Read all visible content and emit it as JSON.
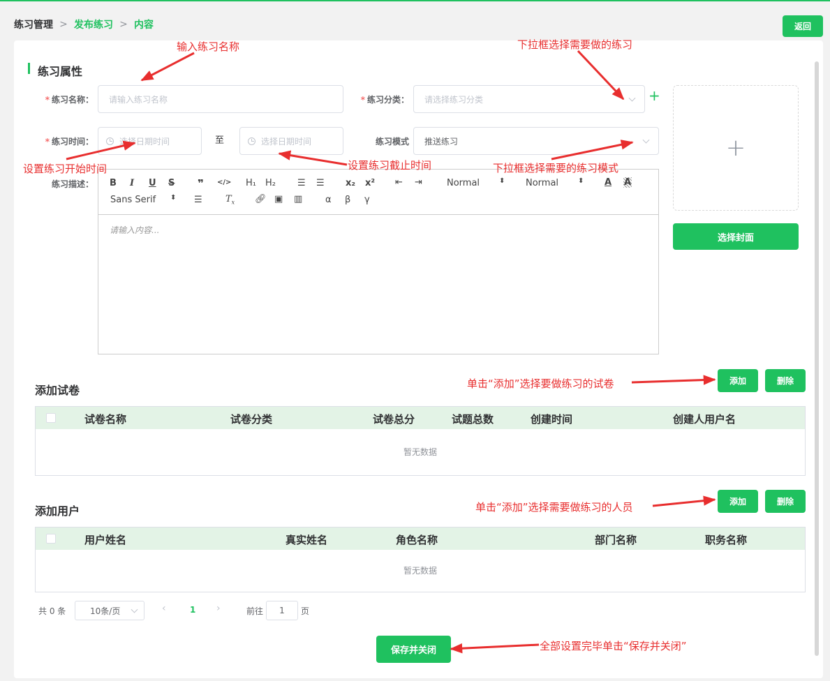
{
  "breadcrumb": {
    "level1": "练习管理",
    "level2": "发布练习",
    "level3": "内容",
    "separator": ">"
  },
  "header": {
    "back_label": "返回"
  },
  "section": {
    "title": "练习属性"
  },
  "form": {
    "required_mark": "*",
    "name_label": "练习名称：",
    "name_placeholder": "请输入练习名称",
    "category_label": "练习分类：",
    "category_placeholder": "请选择练习分类",
    "time_label": "练习时间：",
    "start_placeholder": "选择日期时间",
    "to_label": "至",
    "end_placeholder": "选择日期时间",
    "mode_label": "练习模式",
    "mode_value": "推送练习",
    "desc_label": "练习描述：",
    "add_category_icon": "+"
  },
  "editor": {
    "placeholder": "请输入内容...",
    "toolbar": {
      "bold": "B",
      "italic": "I",
      "underline": "U",
      "strike": "S",
      "blockquote": "❞",
      "code": "</>",
      "h1": "H₁",
      "h2": "H₂",
      "ordered_list": "☰",
      "bullet_list": "☰",
      "sub": "x₂",
      "sup": "x²",
      "outdent": "⇤",
      "indent": "⇥",
      "size_select": "Normal",
      "header_select": "Normal",
      "font_select": "Sans Serif",
      "alpha": "α",
      "beta": "β",
      "gamma": "γ"
    }
  },
  "cover": {
    "plus": "+",
    "select_label": "选择封面"
  },
  "papers": {
    "title": "添加试卷",
    "add_label": "添加",
    "delete_label": "删除",
    "columns": [
      "试卷名称",
      "试卷分类",
      "试卷总分",
      "试题总数",
      "创建时间",
      "创建人用户名"
    ],
    "empty_text": "暂无数据"
  },
  "users": {
    "title": "添加用户",
    "add_label": "添加",
    "delete_label": "删除",
    "columns": [
      "用户姓名",
      "真实姓名",
      "角色名称",
      "部门名称",
      "职务名称"
    ],
    "empty_text": "暂无数据"
  },
  "pagination": {
    "total": "共 0 条",
    "page_size": "10条/页",
    "current_page": "1",
    "goto_prefix": "前往",
    "goto_value": "1",
    "goto_suffix": "页"
  },
  "footer": {
    "save_label": "保存并关闭"
  },
  "annotations": {
    "name": "输入练习名称",
    "category": "下拉框选择需要做的练习",
    "start_time": "设置练习开始时间",
    "end_time": "设置练习截止时间",
    "mode": "下拉框选择需要的练习模式",
    "add_paper": "单击“添加”选择要做练习的试卷",
    "add_user": "单击“添加”选择需要做练习的人员",
    "save": "全部设置完毕单击“保存并关闭”"
  },
  "colors": {
    "accent": "#1fc15f",
    "annotation": "#e82e2e",
    "table_header": "#e3f3e6"
  }
}
